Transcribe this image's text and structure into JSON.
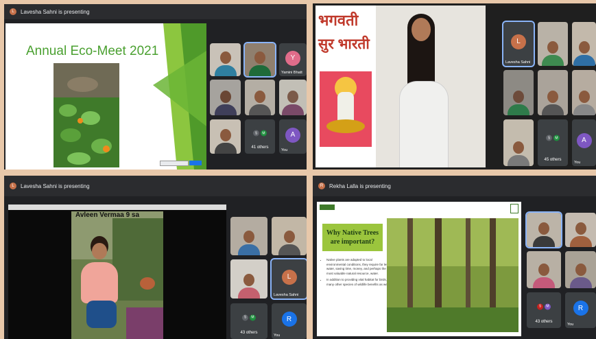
{
  "p1": {
    "presenter": "Lavesha Sahni is presenting",
    "presenter_initial": "L",
    "slide_title": "Annual Eco-Meet 2021",
    "tiles": [
      "",
      "",
      "Yamini Bhatt",
      "",
      "",
      "",
      "",
      "",
      "41 others",
      "You"
    ],
    "yamini_initial": "Y",
    "dot1": "S",
    "dot2": "M",
    "you_initial": "A",
    "you": "You",
    "others": "41 others"
  },
  "p2": {
    "poster_line1": "भगवती",
    "poster_line2": "सुर भारती",
    "tiles": [
      "Lavesha Sahni",
      "",
      "",
      "",
      "",
      "",
      "",
      "45 others",
      "You"
    ],
    "lavesha_initial": "L",
    "dot1": "S",
    "dot2": "M",
    "you_initial": "A",
    "you": "You",
    "others": "45 others"
  },
  "p3": {
    "presenter": "Lavesha Sahni is presenting",
    "presenter_initial": "L",
    "video_caption": "Avleen Vermaa 9 sa",
    "tiles": [
      "",
      "",
      "",
      "",
      "Lavesha Sahni",
      "43 others",
      "You"
    ],
    "lavesha_initial": "L",
    "dot1": "S",
    "dot2": "M",
    "you_initial": "R",
    "you": "You",
    "others": "43 others"
  },
  "p4": {
    "presenter": "Rekha Lalla is presenting",
    "presenter_initial": "R",
    "slide_title": "Why Native Trees are important?",
    "bullets": [
      "Native plants are adapted to local environmental conditions, they require far less water, saving time, money, and perhaps the most valuable natural resource, water.",
      "In addition to providing vital habitat for birds, many other species of wildlife benefits as well."
    ],
    "tiles": [
      "",
      "",
      "",
      "",
      "43 others",
      "You"
    ],
    "dot1": "S",
    "dot2": "M",
    "you_initial": "R",
    "you": "You",
    "others": "43 others"
  },
  "colors": {
    "green": "#5aa02c",
    "meet_bg": "#202124",
    "tile": "#3c4043",
    "page": "#e8c8aa"
  }
}
